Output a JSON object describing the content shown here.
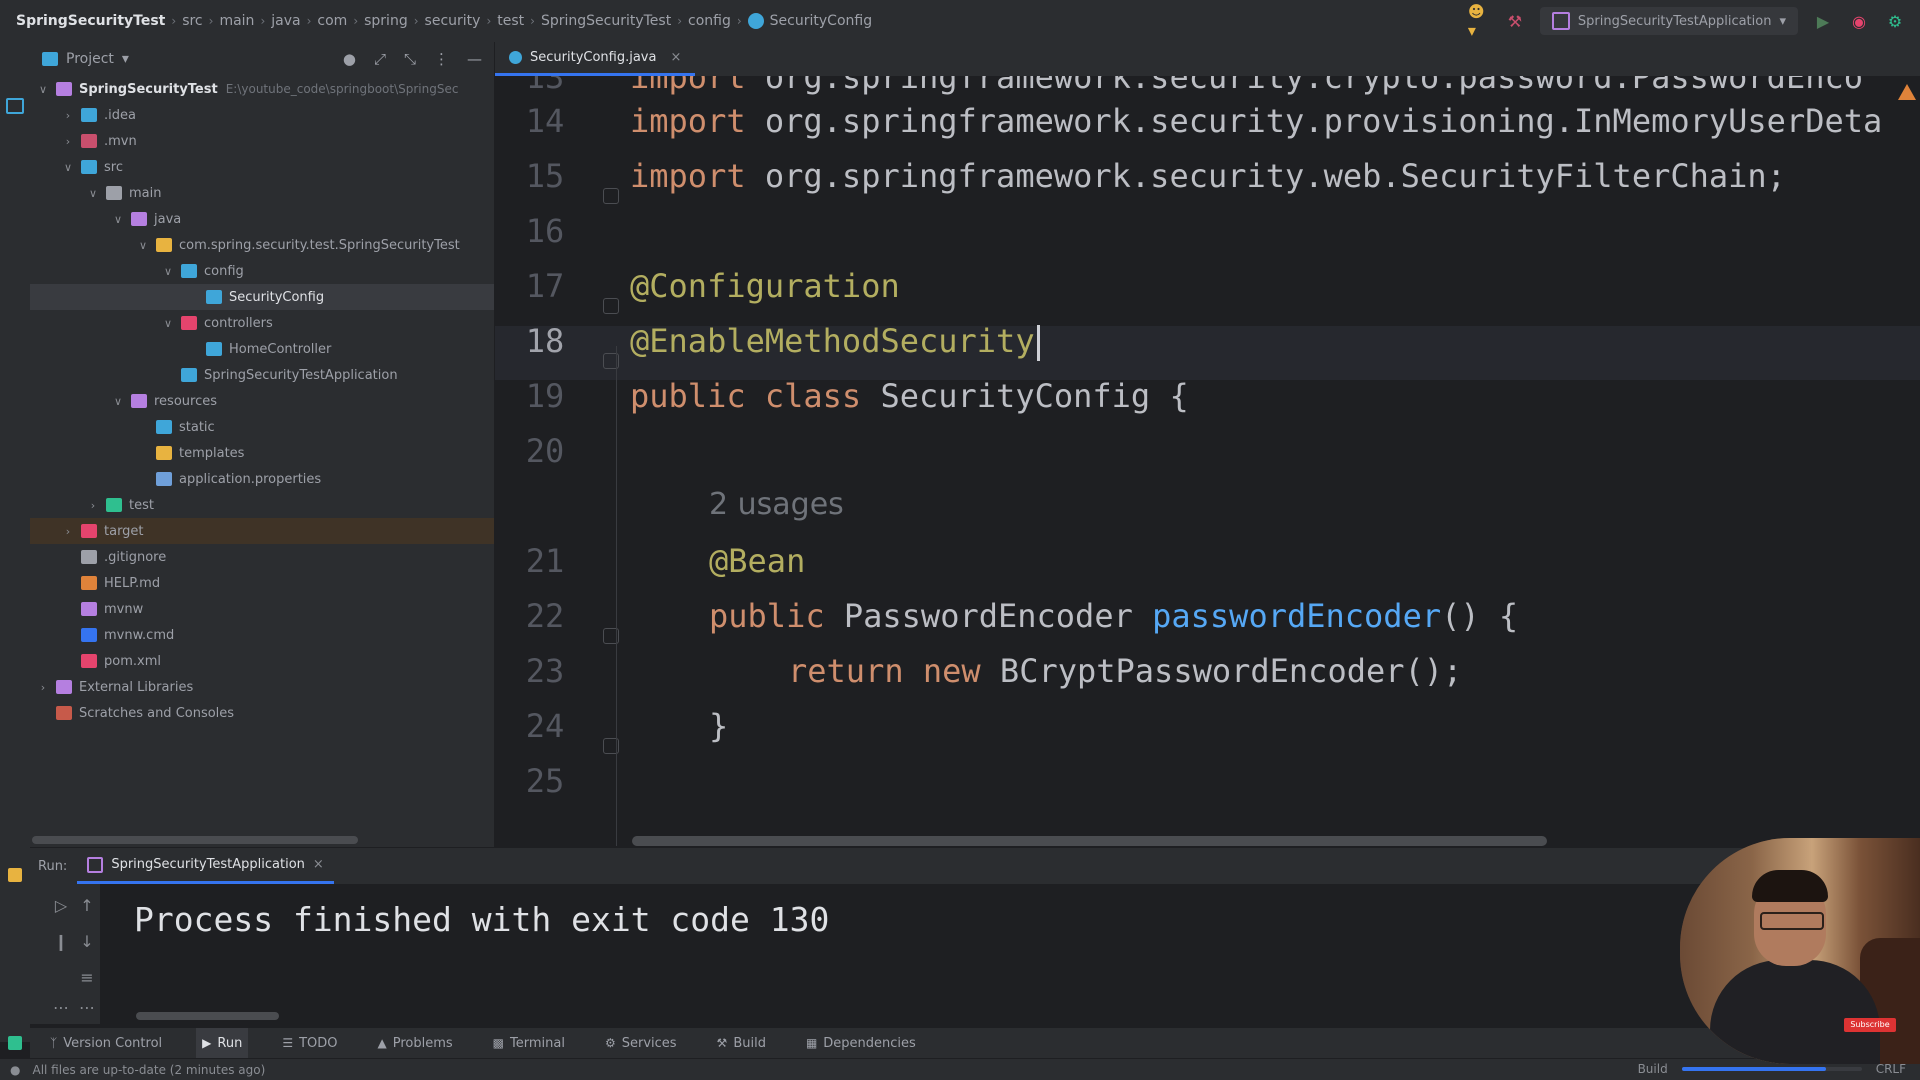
{
  "breadcrumb": {
    "items": [
      "SpringSecurityTest",
      "src",
      "main",
      "java",
      "com",
      "spring",
      "security",
      "test",
      "SpringSecurityTest",
      "config",
      "SecurityConfig"
    ]
  },
  "toolbar": {
    "run_config": "SpringSecurityTestApplication"
  },
  "project_panel": {
    "title": "Project",
    "tree": [
      {
        "label": "SpringSecurityTest",
        "hint": "E:\\youtube_code\\springboot\\SpringSec",
        "indent": 0,
        "arrow": "v",
        "color": "#b57fe0",
        "bold": true
      },
      {
        "label": ".idea",
        "indent": 1,
        "arrow": ">",
        "color": "#3fa6d9"
      },
      {
        "label": ".mvn",
        "indent": 1,
        "arrow": ">",
        "color": "#c94f6d"
      },
      {
        "label": "src",
        "indent": 1,
        "arrow": "v",
        "color": "#3fa6d9"
      },
      {
        "label": "main",
        "indent": 2,
        "arrow": "v",
        "color": "#9da0a8"
      },
      {
        "label": "java",
        "indent": 3,
        "arrow": "v",
        "color": "#b57fe0"
      },
      {
        "label": "com.spring.security.test.SpringSecurityTest",
        "indent": 4,
        "arrow": "v",
        "color": "#e8b340"
      },
      {
        "label": "config",
        "indent": 5,
        "arrow": "v",
        "color": "#3fa6d9"
      },
      {
        "label": "SecurityConfig",
        "indent": 6,
        "arrow": "",
        "color": "#3fa6d9",
        "selected": true
      },
      {
        "label": "controllers",
        "indent": 5,
        "arrow": "v",
        "color": "#e5446d"
      },
      {
        "label": "HomeController",
        "indent": 6,
        "arrow": "",
        "color": "#3fa6d9"
      },
      {
        "label": "SpringSecurityTestApplication",
        "indent": 5,
        "arrow": "",
        "color": "#3fa6d9"
      },
      {
        "label": "resources",
        "indent": 3,
        "arrow": "v",
        "color": "#b57fe0"
      },
      {
        "label": "static",
        "indent": 4,
        "arrow": "",
        "color": "#3fa6d9"
      },
      {
        "label": "templates",
        "indent": 4,
        "arrow": "",
        "color": "#e8b340"
      },
      {
        "label": "application.properties",
        "indent": 4,
        "arrow": "",
        "color": "#6f9fd9"
      },
      {
        "label": "test",
        "indent": 2,
        "arrow": ">",
        "color": "#2fbf8f"
      },
      {
        "label": "target",
        "indent": 1,
        "arrow": ">",
        "color": "#e5446d",
        "target": true
      },
      {
        "label": ".gitignore",
        "indent": 1,
        "arrow": "",
        "color": "#9da0a8"
      },
      {
        "label": "HELP.md",
        "indent": 1,
        "arrow": "",
        "color": "#e0833a"
      },
      {
        "label": "mvnw",
        "indent": 1,
        "arrow": "",
        "color": "#b57fe0"
      },
      {
        "label": "mvnw.cmd",
        "indent": 1,
        "arrow": "",
        "color": "#3574f0"
      },
      {
        "label": "pom.xml",
        "indent": 1,
        "arrow": "",
        "color": "#e5446d"
      },
      {
        "label": "External Libraries",
        "indent": 0,
        "arrow": ">",
        "color": "#b57fe0"
      },
      {
        "label": "Scratches and Consoles",
        "indent": 0,
        "arrow": "",
        "color": "#c75a4a"
      }
    ]
  },
  "editor": {
    "tab_label": "SecurityConfig.java",
    "gutter": [
      "13",
      "14",
      "15",
      "16",
      "17",
      "18",
      "19",
      "20",
      "",
      "21",
      "22",
      "23",
      "24",
      "25"
    ],
    "lines": {
      "l13_kw": "import",
      "l13_rest": " org.springframework.security.crypto.password.PasswordEnco",
      "l14_kw": "import",
      "l14_rest": " org.springframework.security.provisioning.InMemoryUserDeta",
      "l15_kw": "import",
      "l15_rest": " org.springframework.security.web.SecurityFilterChain;",
      "l17": "@Configuration",
      "l18": "@EnableMethodSecurity",
      "l19_kw": "public class",
      "l19_rest": " SecurityConfig {",
      "usages": "2 usages",
      "l21": "@Bean",
      "l22_kw": "public",
      "l22_type": " PasswordEncoder ",
      "l22_fn": "passwordEncoder",
      "l22_rest": "() {",
      "l23_kw": "return new",
      "l23_rest": " BCryptPasswordEncoder();",
      "l24": "}"
    }
  },
  "run_panel": {
    "label": "Run:",
    "tab": "SpringSecurityTestApplication",
    "console": "Process finished with exit code 130"
  },
  "tool_tabs": [
    "Version Control",
    "Run",
    "TODO",
    "Problems",
    "Terminal",
    "Services",
    "Build",
    "Dependencies"
  ],
  "status": {
    "message": "All files are up-to-date (2 minutes ago)",
    "build_label": "Build",
    "line_sep": "CRLF",
    "build_progress": 0.8
  },
  "webcam": {
    "subscribe": "Subscribe"
  }
}
